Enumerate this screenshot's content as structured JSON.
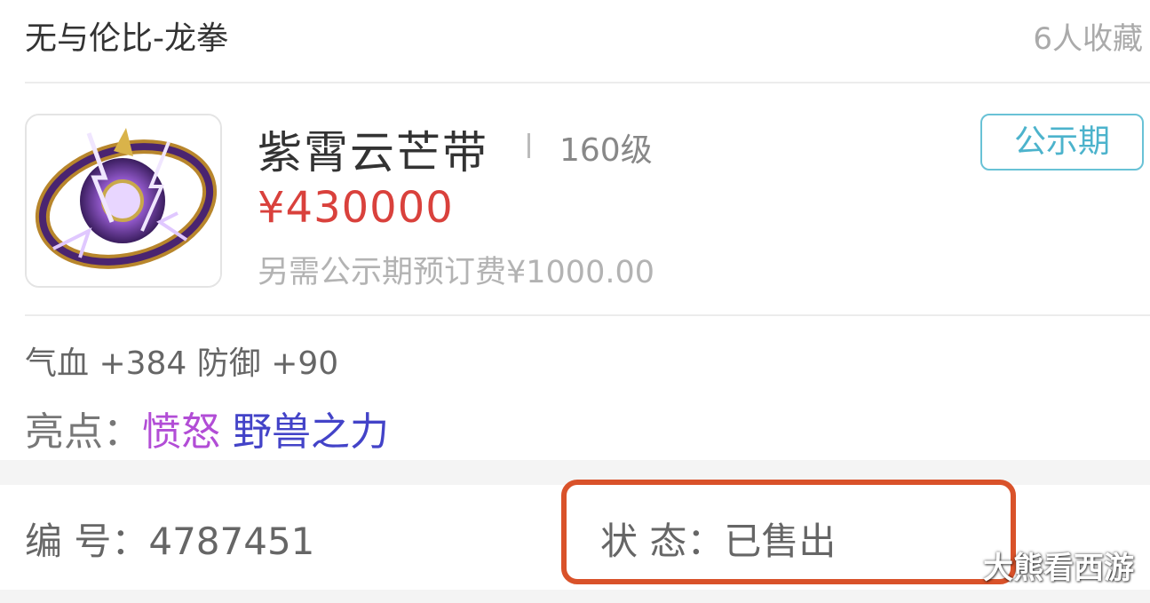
{
  "header": {
    "server_name": "无与伦比-龙拳",
    "favorites": "6人收藏"
  },
  "item": {
    "icon": "purple-thunder-belt-icon",
    "name": "紫霄云芒带",
    "level": "160级",
    "status_tag": "公示期",
    "price": "¥430000",
    "fee": "另需公示期预订费¥1000.00"
  },
  "stats": {
    "text": "气血 +384 防御 +90"
  },
  "highlights": {
    "label": "亮点：",
    "items": [
      "愤怒",
      "野兽之力"
    ]
  },
  "info": {
    "serial": "编  号：4787451",
    "state": "状  态：已售出"
  },
  "watermark": "大熊看西游",
  "colors": {
    "price": "#d9413c",
    "tag": "#4cb3cc",
    "highlight_1": "#b24dd6",
    "highlight_2": "#4343c8",
    "annotation_box": "#d9522a"
  }
}
